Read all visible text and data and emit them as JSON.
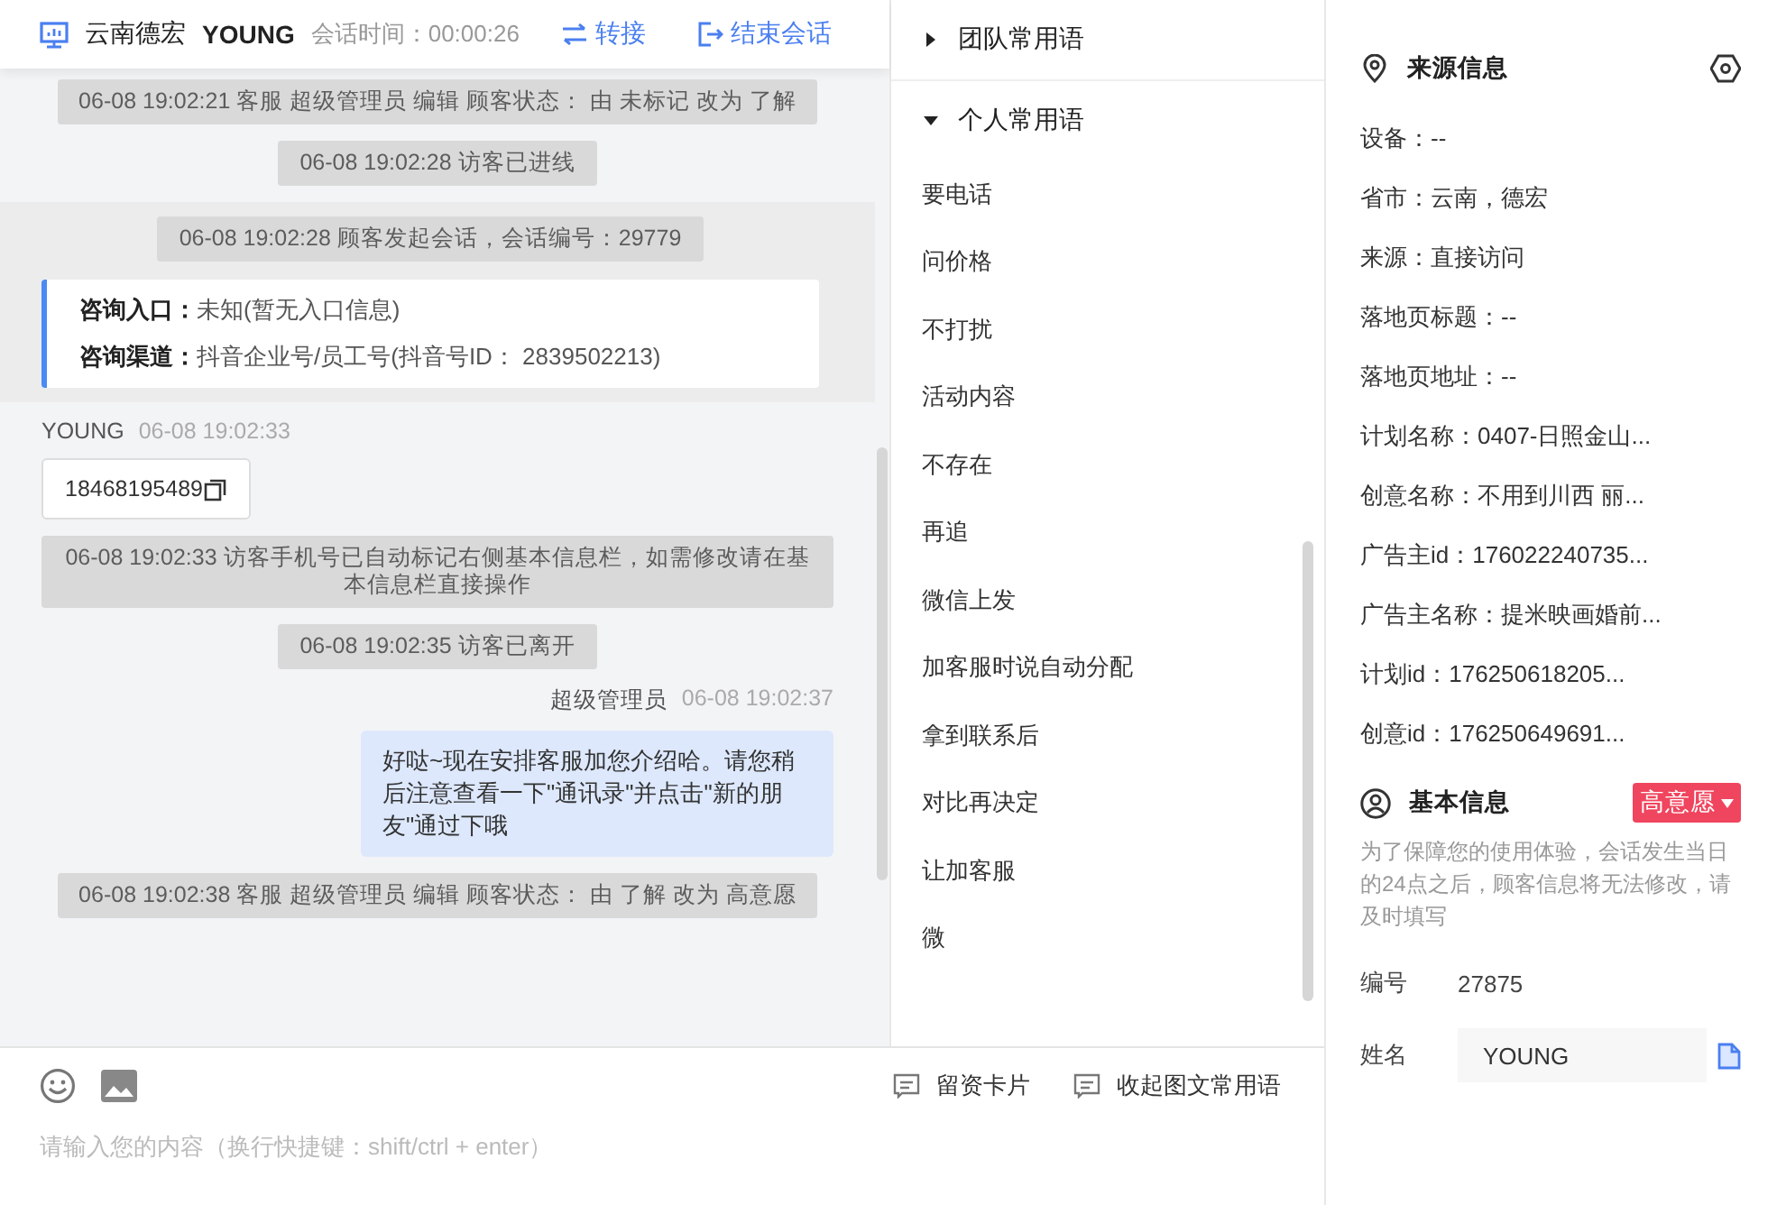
{
  "header": {
    "shop": "云南德宏",
    "visitor": "YOUNG",
    "timer_label": "会话时间：",
    "timer": "00:00:26",
    "actions": [
      {
        "kind": "transfer",
        "label": "转接"
      },
      {
        "kind": "end",
        "label": "结束会话"
      }
    ]
  },
  "chat": [
    {
      "kind": "system",
      "text": "06-08 19:02:21 客服 超级管理员 编辑 顾客状态： 由 未标记 改为 了解"
    },
    {
      "kind": "system",
      "text": "06-08 19:02:28 访客已进线"
    },
    {
      "kind": "session",
      "system": "06-08 19:02:28 顾客发起会话，会话编号：29779",
      "info": [
        {
          "label": "咨询入口：",
          "value": "未知(暂无入口信息)"
        },
        {
          "label": "咨询渠道：",
          "value": "抖音企业号/员工号(抖音号ID： 2839502213)"
        }
      ]
    },
    {
      "kind": "visitor",
      "name": "YOUNG",
      "time": "06-08 19:02:33",
      "text": "18468195489"
    },
    {
      "kind": "system",
      "text": "06-08 19:02:33 访客手机号已自动标记右侧基本信息栏，如需修改请在基本信息栏直接操作"
    },
    {
      "kind": "system",
      "text": "06-08 19:02:35 访客已离开"
    },
    {
      "kind": "agent",
      "name": "超级管理员",
      "time": "06-08 19:02:37",
      "text": "好哒~现在安排客服加您介绍哈。请您稍后注意查看一下\"通讯录\"并点击\"新的朋友\"通过下哦"
    },
    {
      "kind": "system",
      "text": "06-08 19:02:38 客服 超级管理员 编辑 顾客状态： 由 了解 改为 高意愿"
    }
  ],
  "composer": {
    "tools": [
      {
        "label": "留资卡片"
      },
      {
        "label": "收起图文常用语"
      }
    ],
    "placeholder": "请输入您的内容（换行快捷键：shift/ctrl + enter）"
  },
  "phrases": [
    {
      "title": "团队常用语",
      "expanded": false
    },
    {
      "title": "个人常用语",
      "expanded": true,
      "items": [
        "要电话",
        "问价格",
        "不打扰",
        "活动内容",
        "不存在",
        "再追",
        "微信上发",
        "加客服时说自动分配",
        "拿到联系后",
        "对比再决定",
        "让加客服",
        "微"
      ]
    }
  ],
  "source_info": {
    "title": "来源信息",
    "fields": [
      "设备：--",
      "省市：云南，德宏",
      "来源：直接访问",
      "落地页标题：--",
      "落地页地址：--",
      "计划名称：0407-日照金山...",
      "创意名称：不用到川西 丽...",
      "广告主id：176022240735...",
      "广告主名称：提米映画婚前...",
      "计划id：176250618205...",
      "创意id：176250649691..."
    ]
  },
  "basic_info": {
    "title": "基本信息",
    "status": "高意愿",
    "notice": "为了保障您的使用体验，会话发生当日的24点之后，顾客信息将无法修改，请及时填写",
    "id_label": "编号",
    "id": "27875",
    "name_label": "姓名",
    "name": "YOUNG"
  }
}
